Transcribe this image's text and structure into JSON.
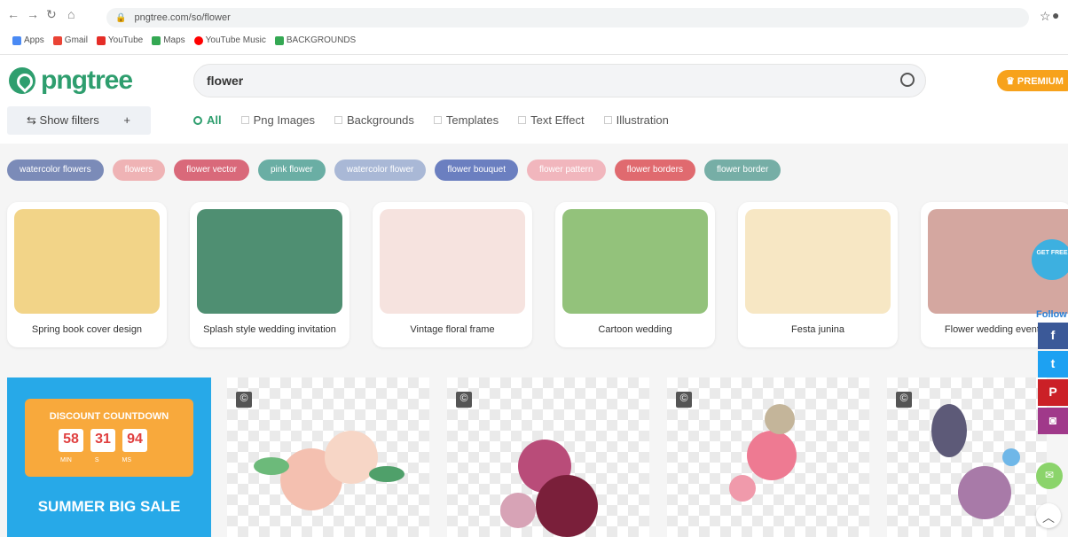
{
  "browser": {
    "url": "pngtree.com/so/flower",
    "bookmarks": [
      "Apps",
      "Gmail",
      "YouTube",
      "Maps",
      "YouTube Music",
      "BACKGROUNDS"
    ]
  },
  "header": {
    "logo_text": "pngtree",
    "search_value": "flower",
    "premium_label": "PREMIUM",
    "show_filters_label": "Show filters",
    "tabs": [
      {
        "label": "All",
        "active": true
      },
      {
        "label": "Png Images",
        "active": false
      },
      {
        "label": "Backgrounds",
        "active": false
      },
      {
        "label": "Templates",
        "active": false
      },
      {
        "label": "Text Effect",
        "active": false
      },
      {
        "label": "Illustration",
        "active": false
      }
    ]
  },
  "chips": [
    {
      "label": "watercolor flowers",
      "color": "#7b8bb8"
    },
    {
      "label": "flowers",
      "color": "#efb3b5"
    },
    {
      "label": "flower vector",
      "color": "#d9697a"
    },
    {
      "label": "pink flower",
      "color": "#6aaea4"
    },
    {
      "label": "watercolor flower",
      "color": "#a9b8d6"
    },
    {
      "label": "flower bouquet",
      "color": "#6b7fc0"
    },
    {
      "label": "flower pattern",
      "color": "#f1b6bd"
    },
    {
      "label": "flower borders",
      "color": "#e06a6f"
    },
    {
      "label": "flower border",
      "color": "#76aea6"
    }
  ],
  "cards": [
    {
      "title": "Spring book cover design",
      "color": "#f2d488"
    },
    {
      "title": "Splash style wedding invitation",
      "color": "#4f8f72"
    },
    {
      "title": "Vintage floral frame",
      "color": "#f6e3df"
    },
    {
      "title": "Cartoon wedding",
      "color": "#93c27b"
    },
    {
      "title": "Festa junina",
      "color": "#f7e7c4"
    },
    {
      "title": "Flower wedding event p",
      "color": "#d4a7a0"
    }
  ],
  "promo": {
    "title": "DISCOUNT COUNTDOWN",
    "countdown": [
      "58",
      "31",
      "94"
    ],
    "labels": [
      "MIN",
      "S",
      "MS"
    ],
    "sale_text": "SUMMER BIG SALE"
  },
  "sidebar": {
    "get_free_label": "GET FREE",
    "follow_label": "Follow",
    "social": [
      {
        "icon": "facebook-icon",
        "glyph": "f",
        "color": "#3b5998"
      },
      {
        "icon": "twitter-icon",
        "glyph": "t",
        "color": "#1da1f2"
      },
      {
        "icon": "pinterest-icon",
        "glyph": "P",
        "color": "#cb2027"
      },
      {
        "icon": "instagram-icon",
        "glyph": "◙",
        "color": "#a0398a"
      }
    ]
  },
  "tiles": [
    {
      "badge": "©"
    },
    {
      "badge": "©"
    },
    {
      "badge": "©"
    },
    {
      "badge": "©"
    }
  ]
}
